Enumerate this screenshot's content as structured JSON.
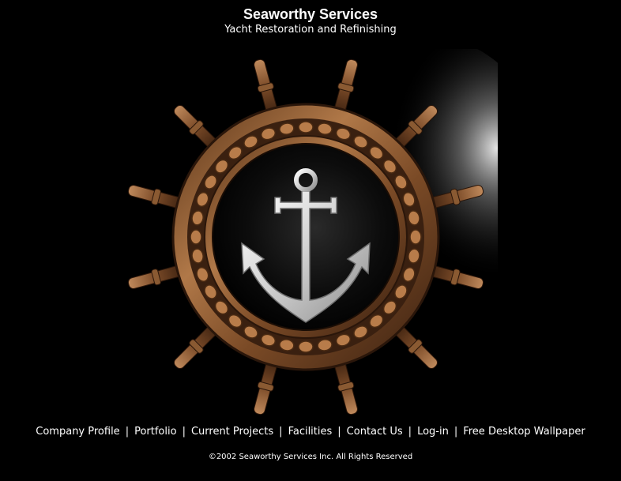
{
  "header": {
    "title": "Seaworthy Services",
    "subtitle": "Yacht Restoration and Refinishing"
  },
  "hero": {
    "image_name": "ships-wheel-anchor-emblem",
    "colors": {
      "background": "#000000",
      "wheel_bronze": "#8a5a32",
      "wheel_highlight": "#d9a070",
      "anchor_silver": "#d8d8d8"
    }
  },
  "nav": {
    "items": [
      {
        "label": "Company Profile"
      },
      {
        "label": "Portfolio"
      },
      {
        "label": "Current Projects"
      },
      {
        "label": "Facilities"
      },
      {
        "label": "Contact Us"
      },
      {
        "label": "Log-in"
      },
      {
        "label": "Free Desktop Wallpaper"
      }
    ],
    "separator": "|"
  },
  "footer": {
    "copyright": "©2002 Seaworthy Services Inc. All Rights Reserved"
  }
}
